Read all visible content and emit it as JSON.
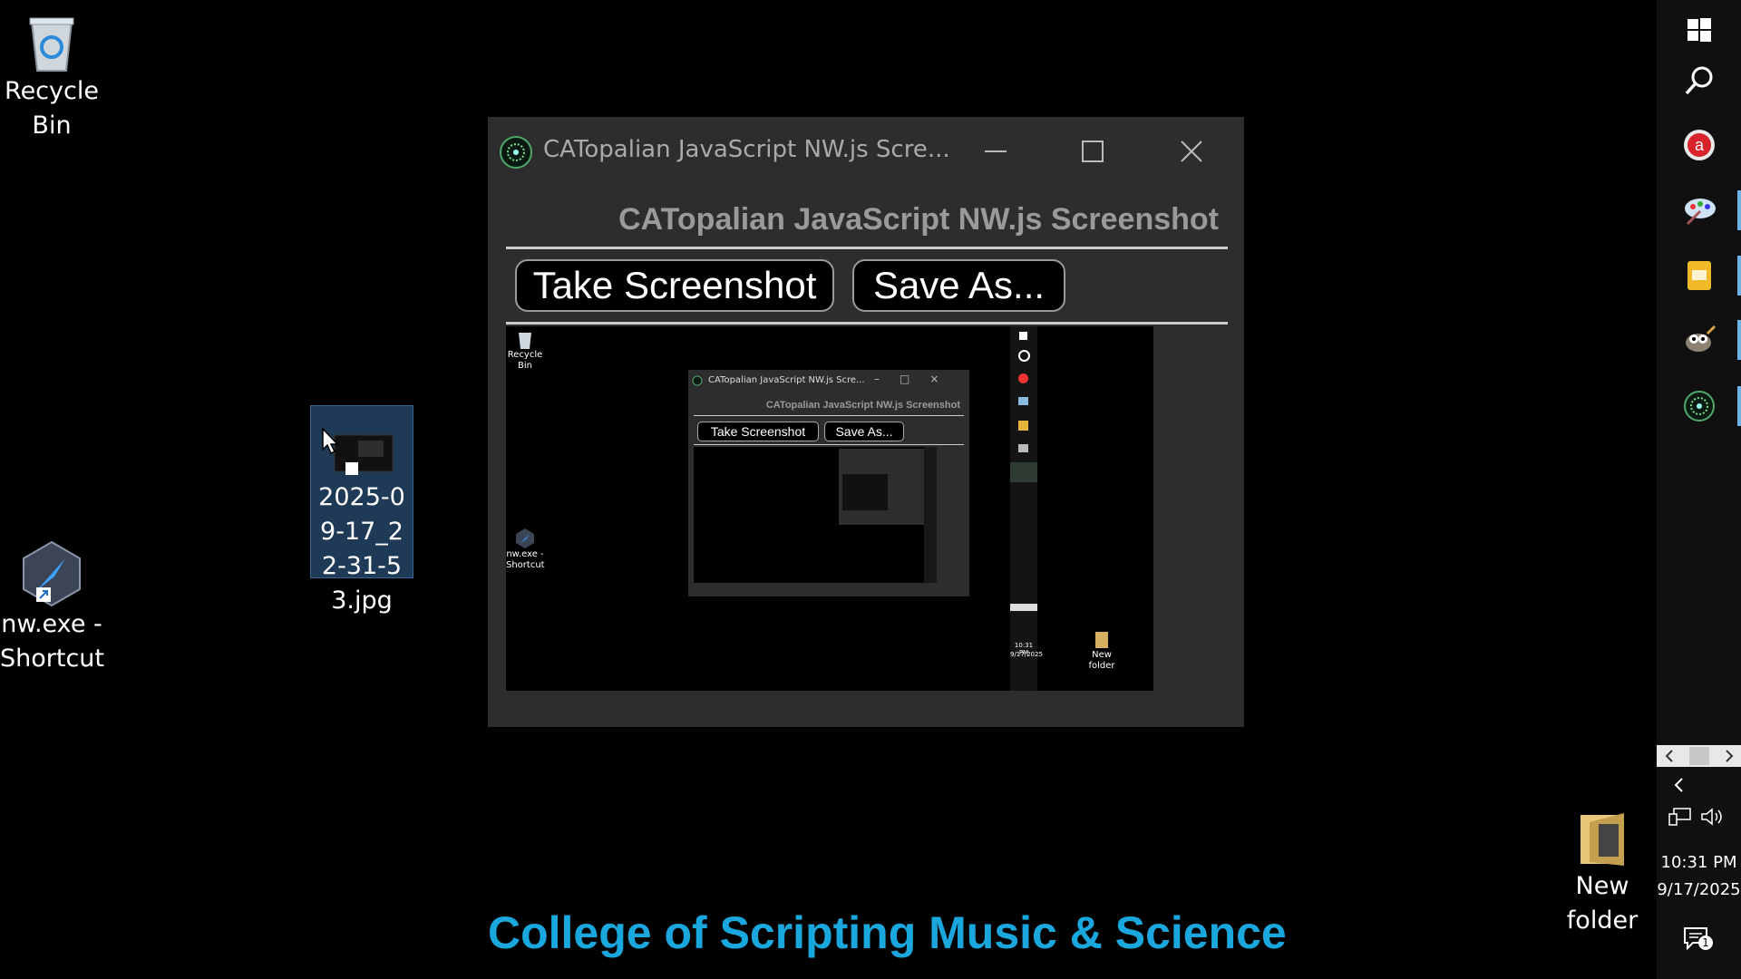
{
  "desktop": {
    "icons": [
      {
        "label": "Recycle Bin"
      },
      {
        "label": "nw.exe - Shortcut"
      },
      {
        "label": "2025-09-17_22-31-53.jpg"
      },
      {
        "label": "New folder"
      }
    ]
  },
  "window": {
    "title": "CATopalian JavaScript NW.js Scre...",
    "header": "CATopalian JavaScript NW.js Screenshot",
    "buttons": {
      "take_screenshot": "Take Screenshot",
      "save_as": "Save As..."
    },
    "preview": {
      "title": "CATopalian JavaScript NW.js Scre...",
      "header": "CATopalian JavaScript NW.js Screenshot",
      "take_screenshot": "Take Screenshot",
      "save_as": "Save As...",
      "recycle_label": "Recycle Bin",
      "nw_label": "nw.exe - Shortcut",
      "newfolder_label": "New folder",
      "time": "10:31 PM",
      "date": "9/17/2025"
    }
  },
  "footer": {
    "text": "College of Scripting Music & Science"
  },
  "taskbar": {
    "items": [
      "windows-icon",
      "search-icon",
      "acrobat-icon",
      "paint-icon",
      "slides-icon",
      "gimp-icon",
      "nwjs-app-icon"
    ],
    "time": "10:31 PM",
    "date": "9/17/2025",
    "notification_count": "1"
  }
}
